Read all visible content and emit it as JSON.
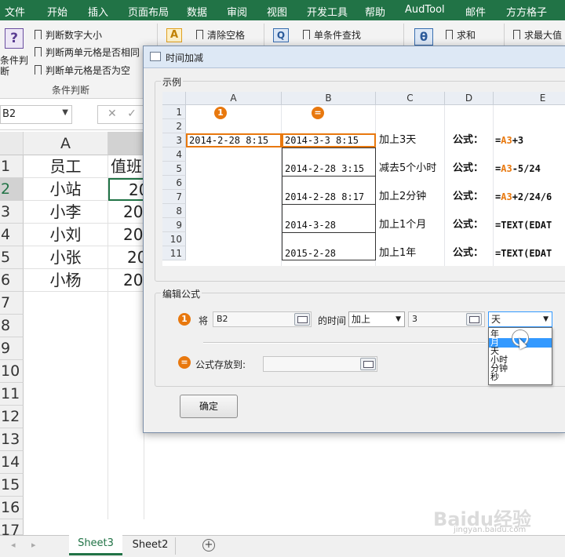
{
  "ribbon_tabs": [
    "文件",
    "开始",
    "插入",
    "页面布局",
    "数据",
    "审阅",
    "视图",
    "开发工具",
    "帮助",
    "AudTool",
    "邮件",
    "方方格子"
  ],
  "ribbon": {
    "big_button_label": "条件判断",
    "big_button_icon": "?",
    "items": [
      "判断数字大小",
      "判断两单元格是否相同",
      "判断单元格是否为空"
    ],
    "group_label": "条件判断",
    "col2_item": "清除空格",
    "col3_item": "单条件查找",
    "col4_item": "求和",
    "col5_item": "求最大值",
    "col2_icon": "A",
    "col3_icon": "Q",
    "col4_icon": "θ"
  },
  "formula_bar": {
    "name_box": "B2",
    "cancel_symbol": "✕",
    "confirm_symbol": "✓"
  },
  "sheet": {
    "columns": [
      "A"
    ],
    "rows": [
      "1",
      "2",
      "3",
      "4",
      "5",
      "6",
      "7",
      "8",
      "9",
      "10",
      "11",
      "12",
      "13",
      "14",
      "15",
      "16",
      "17"
    ],
    "col_a": [
      "员工",
      "小站",
      "小李",
      "小刘",
      "小张",
      "小杨"
    ],
    "col_b": [
      "值班",
      "20",
      "20",
      "20",
      "20",
      "20"
    ]
  },
  "sheet_tabs": {
    "tabs": [
      "Sheet3",
      "Sheet2"
    ],
    "active": "Sheet3",
    "add_symbol": "+"
  },
  "dialog": {
    "title": "时间加减",
    "example_label": "示例",
    "grid": {
      "columns": [
        "A",
        "B",
        "C",
        "D",
        "E"
      ],
      "rows": [
        "1",
        "2",
        "3",
        "4",
        "5",
        "6",
        "7",
        "8",
        "9",
        "10",
        "11"
      ],
      "badge1": "1",
      "badge2": "=",
      "a3": "2014-2-28 8:15",
      "b3": "2014-3-3 8:15",
      "c3": "加上3天",
      "d3": "公式：",
      "e3_ref": "A3",
      "e3_rest": "+3",
      "b5": "2014-2-28 3:15",
      "c5": "减去5个小时",
      "d5": "公式：",
      "e5_ref": "A3",
      "e5_rest": "-5/24",
      "b7": "2014-2-28 8:17",
      "c7": "加上2分钟",
      "d7": "公式：",
      "e7_ref": "A3",
      "e7_rest": "+2/24/6",
      "b9": "2014-3-28",
      "c9": "加上1个月",
      "d9": "公式：",
      "e9": "=TEXT(EDAT",
      "b11": "2015-2-28",
      "c11": "加上1年",
      "d11": "公式：",
      "e11": "=TEXT(EDAT"
    },
    "edit_label": "编辑公式",
    "row1_badge": "1",
    "jiang_label": "将",
    "source_value": "B2",
    "time_label": "的时间",
    "op_value": "加上",
    "amount_value": "3",
    "unit_value": "天",
    "unit_options": [
      "年",
      "月",
      "天",
      "小时",
      "分钟",
      "秒"
    ],
    "unit_highlight": "月",
    "row2_badge": "=",
    "store_label": "公式存放到:",
    "ok_label": "确定"
  },
  "watermark": "Baidu经验",
  "watermark_sub": "jingyan.baidu.com",
  "colors": {
    "excel_green": "#217346",
    "accent_orange": "#e8780e",
    "highlight_blue": "#3399ff"
  }
}
